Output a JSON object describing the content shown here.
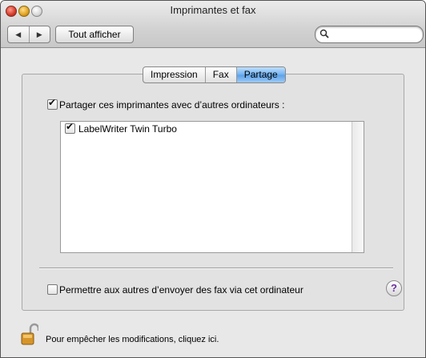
{
  "window": {
    "title": "Imprimantes et fax"
  },
  "toolbar": {
    "back_icon": "back-arrow-icon",
    "forward_icon": "forward-arrow-icon",
    "show_all_label": "Tout afficher",
    "search_value": "",
    "search_icon": "magnifier-icon"
  },
  "tabs": [
    {
      "label": "Impression",
      "selected": false
    },
    {
      "label": "Fax",
      "selected": false
    },
    {
      "label": "Partage",
      "selected": true
    }
  ],
  "sharing": {
    "share_printers_label": "Partager ces imprimantes avec d’autres ordinateurs :",
    "share_printers_checked": true,
    "printers": [
      {
        "name": "LabelWriter Twin Turbo",
        "checked": true
      }
    ],
    "fax_label": "Permettre aux autres d’envoyer des fax via cet ordinateur",
    "fax_checked": false
  },
  "help": {
    "label": "?"
  },
  "lock": {
    "icon": "open-lock-icon",
    "text": "Pour empêcher les modifications, cliquez ici."
  },
  "colors": {
    "selected_tab": "#5aa0ea",
    "help_glyph": "#6a2fa0"
  }
}
